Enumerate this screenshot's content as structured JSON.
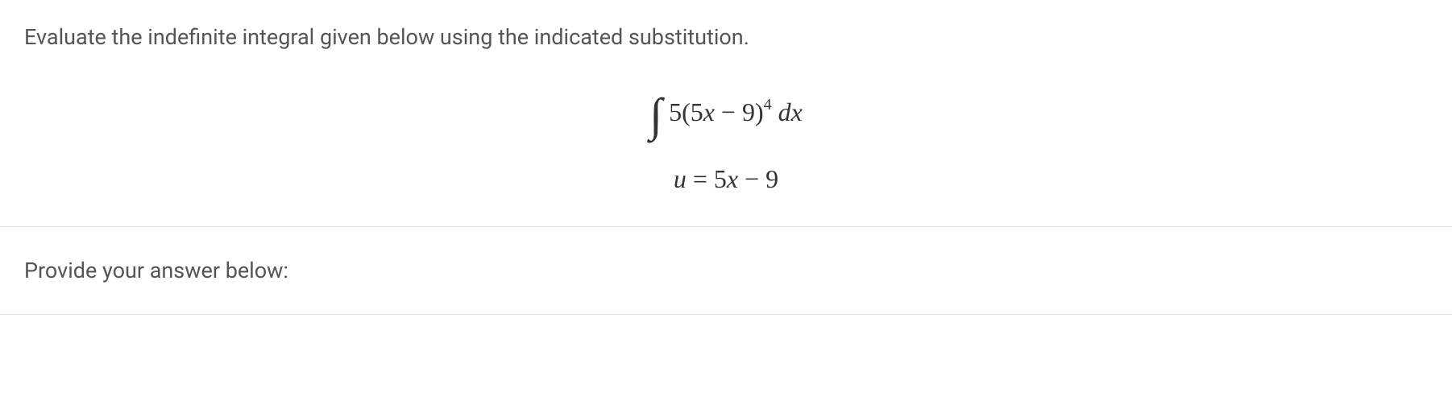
{
  "question": {
    "prompt": "Evaluate the indefinite integral given below using the indicated substitution.",
    "integral": {
      "integrand_prefix": "5(5",
      "integrand_var": "x",
      "integrand_mid": " − 9)",
      "exponent": "4",
      "dx": " dx"
    },
    "substitution": {
      "lhs_var": "u",
      "equals": " = ",
      "rhs_coef": "5",
      "rhs_var": "x",
      "rhs_tail": " − 9"
    }
  },
  "answer_prompt": "Provide your answer below:"
}
